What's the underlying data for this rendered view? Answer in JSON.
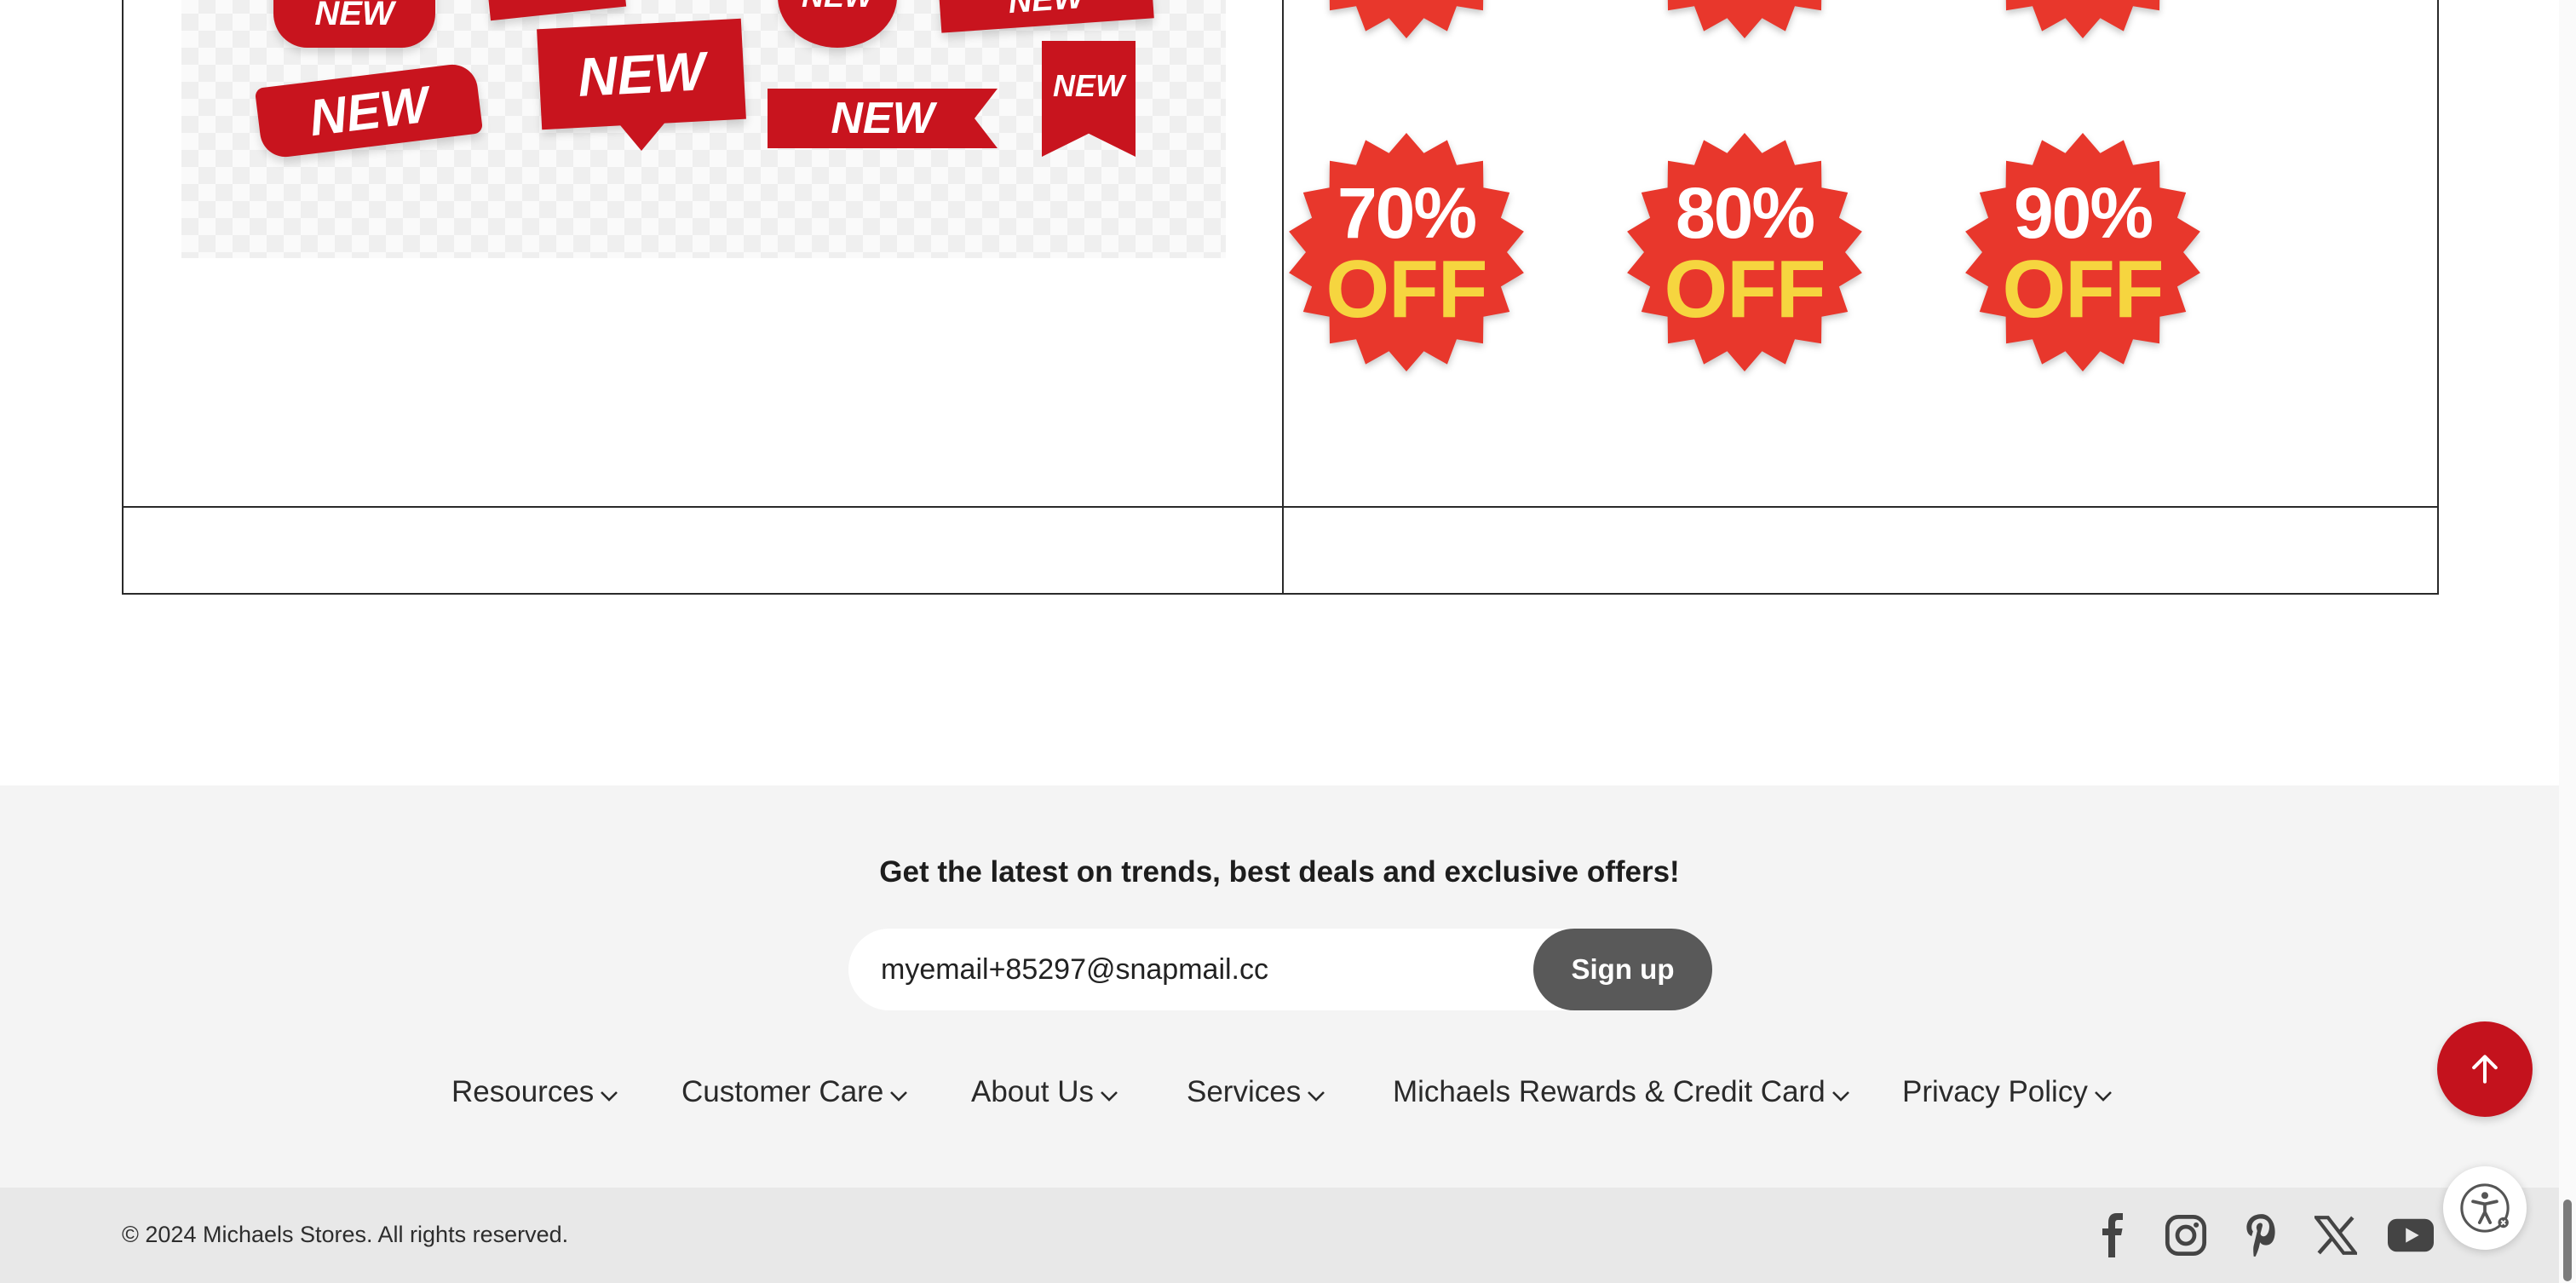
{
  "content": {
    "ribbons_image": {
      "ribbon_text": "NEW"
    },
    "badges": [
      {
        "percent": "70%",
        "label": "OFF"
      },
      {
        "percent": "80%",
        "label": "OFF"
      },
      {
        "percent": "90%",
        "label": "OFF"
      }
    ]
  },
  "newsletter": {
    "title": "Get the latest on trends, best deals and exclusive offers!",
    "email_value": "myemail+85297@snapmail.cc",
    "signup_label": "Sign up"
  },
  "footer_nav": [
    {
      "label": "Resources"
    },
    {
      "label": "Customer Care"
    },
    {
      "label": "About Us"
    },
    {
      "label": "Services"
    },
    {
      "label": "Michaels Rewards & Credit Card"
    },
    {
      "label": "Privacy Policy"
    }
  ],
  "footer_bottom": {
    "copyright": "© 2024 Michaels Stores. All rights reserved.",
    "social_icons": [
      "facebook-icon",
      "instagram-icon",
      "pinterest-icon",
      "x-icon",
      "youtube-icon"
    ]
  },
  "colors": {
    "brand_red": "#c4121d",
    "badge_red": "#e8372c",
    "badge_yellow": "#f6d53f",
    "button_gray": "#595959",
    "footer_bg": "#f4f4f4"
  }
}
